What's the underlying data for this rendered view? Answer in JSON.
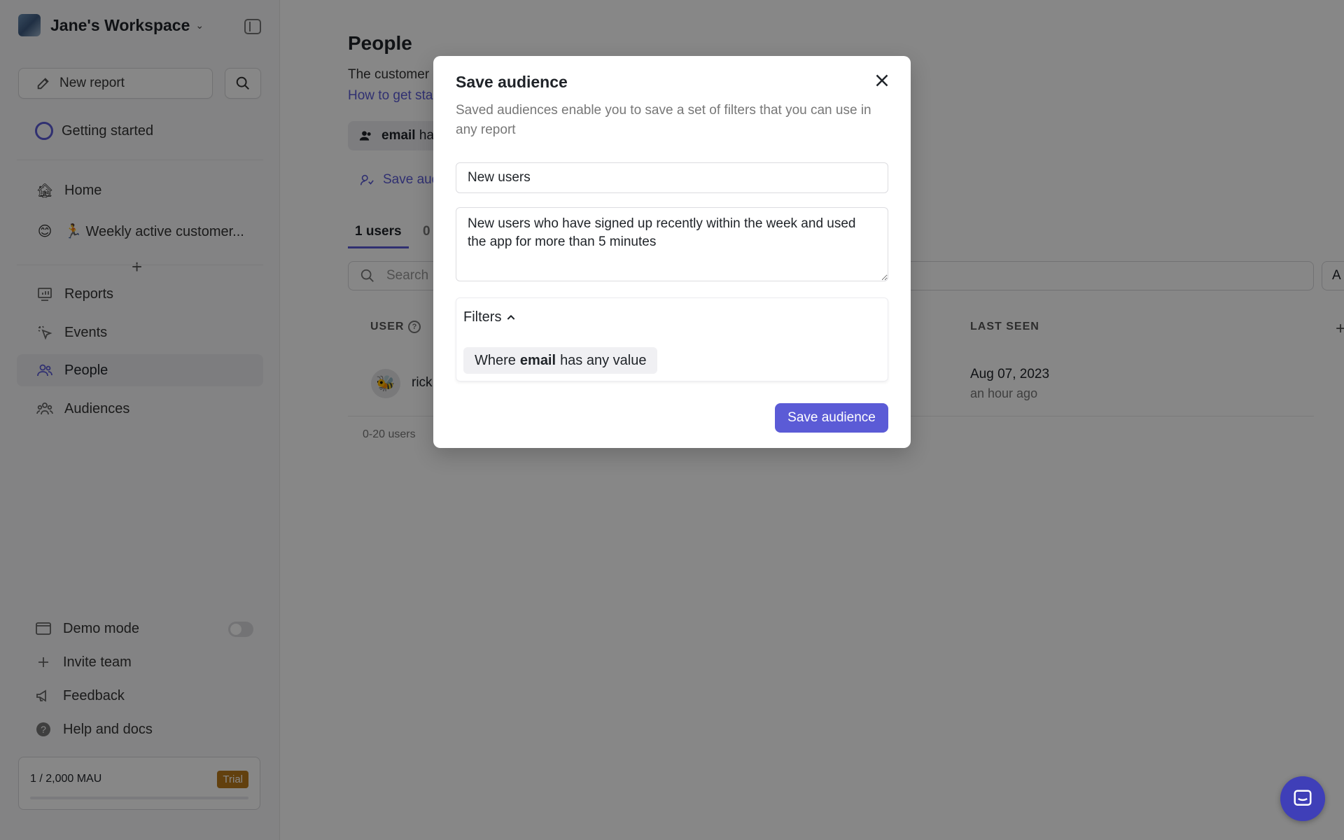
{
  "workspace": {
    "name": "Jane's Workspace"
  },
  "sidebar": {
    "new_report_label": "New report",
    "getting_started_label": "Getting started",
    "reports_items": [
      {
        "label": "Home",
        "icon": "house-emoji"
      },
      {
        "label": "🏃 Weekly active customer...",
        "icon": "smile-emoji"
      }
    ],
    "nav_items": [
      {
        "label": "Reports",
        "icon": "chart-icon"
      },
      {
        "label": "Events",
        "icon": "cursor-click-icon"
      },
      {
        "label": "People",
        "icon": "users-icon",
        "active": true
      },
      {
        "label": "Audiences",
        "icon": "group-icon"
      }
    ],
    "bottom_items": [
      {
        "label": "Demo mode",
        "icon": "window-icon"
      },
      {
        "label": "Invite team",
        "icon": "plus-icon"
      },
      {
        "label": "Feedback",
        "icon": "megaphone-icon"
      },
      {
        "label": "Help and docs",
        "icon": "question-icon"
      }
    ],
    "mau": {
      "text": "1 / 2,000 MAU",
      "badge": "Trial"
    }
  },
  "main": {
    "title": "People",
    "description": "The customer",
    "help_link": "How to get sta",
    "filter_chip": {
      "bold": "email",
      "rest": "ha"
    },
    "save_audience_link": "Save aud",
    "tabs": [
      {
        "label": "1 users",
        "active": true
      },
      {
        "label": "0",
        "active": false
      }
    ],
    "search_placeholder": "Search",
    "add_button_label": "A",
    "columns": {
      "user": "USER",
      "last_seen": "LAST SEEN"
    },
    "rows": [
      {
        "name": "rick",
        "last_seen_date": "Aug 07, 2023",
        "last_seen_ago": "an hour ago"
      }
    ],
    "users_count": "0-20 users"
  },
  "modal": {
    "title": "Save audience",
    "subtitle": "Saved audiences enable you to save a set of filters that you can use in any report",
    "name_value": "New users",
    "description_value": "New users who have signed up recently within the week and used the app for more than 5 minutes",
    "filters_label": "Filters",
    "filter_where": "Where",
    "filter_field": "email",
    "filter_condition": "has any value",
    "save_button_label": "Save audience"
  },
  "colors": {
    "accent": "#5b5bd6",
    "trial": "#b9791c",
    "overlay": "rgba(0,0,0,0.47)"
  }
}
